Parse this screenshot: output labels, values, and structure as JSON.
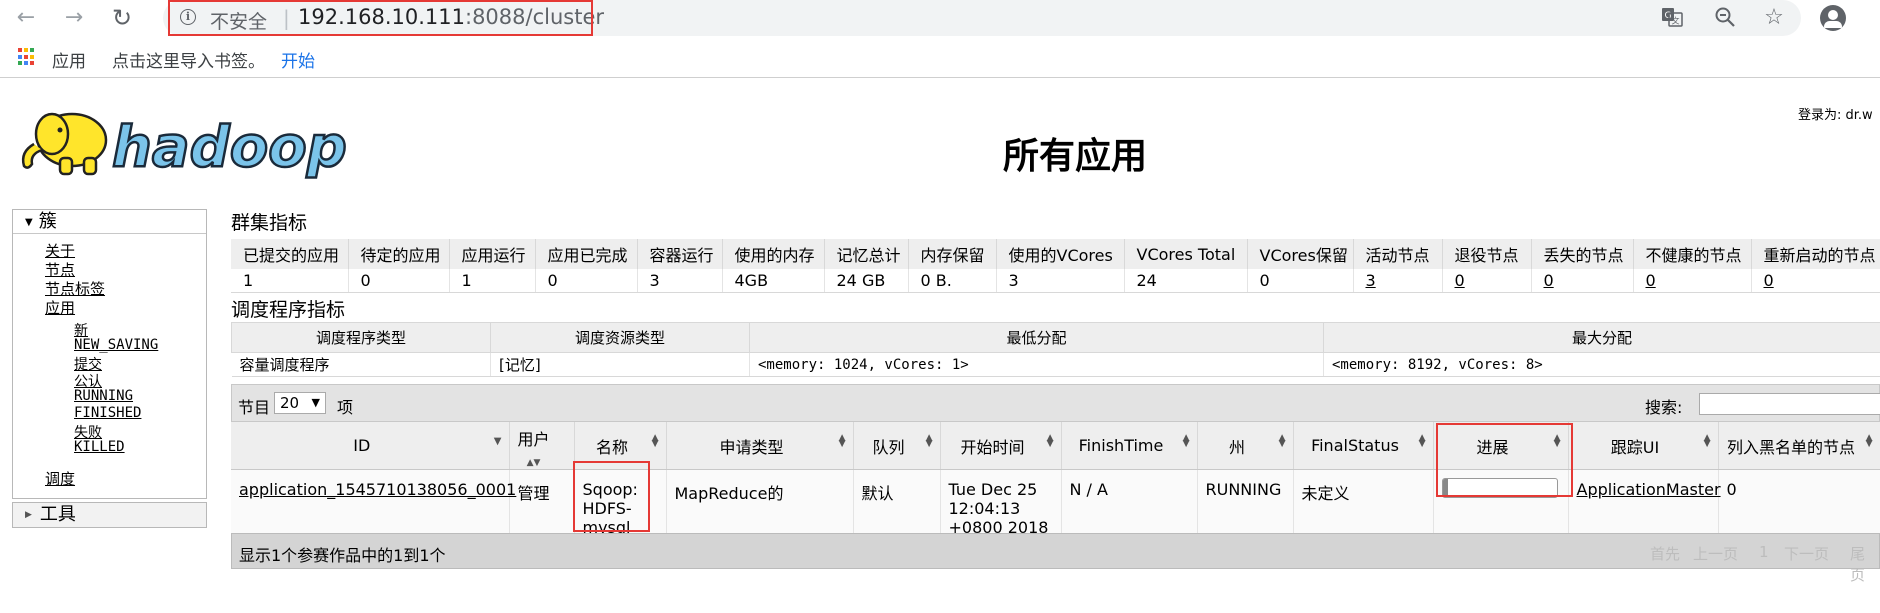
{
  "browser": {
    "not_secure_label": "不安全",
    "url_host": "192.168.10.111",
    "url_rest": ":8088/cluster",
    "bookmarks": {
      "apps_label": "应用",
      "import_hint": "点击这里导入书签。",
      "start_label": "开始"
    },
    "icons": [
      "back-icon",
      "forward-icon",
      "reload-icon",
      "info-icon",
      "translate-icon",
      "zoom-icon",
      "star-icon",
      "profile-icon",
      "apps-grid-icon"
    ]
  },
  "header": {
    "logo_text": "hadoop",
    "page_title": "所有应用",
    "logged_in": "登录为: dr.w"
  },
  "sidebar": {
    "cluster_label": "簇",
    "links": [
      "关于",
      "节点",
      "节点标签",
      "应用"
    ],
    "app_states": [
      "新",
      "NEW_SAVING",
      "提交",
      "公认",
      "RUNNING",
      "FINISHED",
      "失败",
      "KILLED"
    ],
    "scheduler_label": "调度",
    "tools_label": "工具"
  },
  "metrics": {
    "title": "群集指标",
    "headers": [
      "已提交的应用",
      "待定的应用",
      "应用运行",
      "应用已完成",
      "容器运行",
      "使用的内存",
      "记忆总计",
      "内存保留",
      "使用的VCores",
      "VCores Total",
      "VCores保留",
      "活动节点",
      "退役节点",
      "丢失的节点",
      "不健康的节点",
      "重新启动的节点"
    ],
    "values": [
      "1",
      "0",
      "1",
      "0",
      "3",
      "4GB",
      "24 GB",
      "0 B.",
      "3",
      "24",
      "0",
      "3",
      "0",
      "0",
      "0",
      "0"
    ]
  },
  "scheduler": {
    "title": "调度程序指标",
    "headers": [
      "调度程序类型",
      "调度资源类型",
      "最低分配",
      "最大分配"
    ],
    "values": [
      "容量调度程序",
      "[记忆]",
      "<memory: 1024, vCores: 1>",
      "<memory: 8192, vCores: 8>"
    ]
  },
  "apps": {
    "entries_label": "节目",
    "entries_value": "20",
    "entries_suffix": "项",
    "search_label": "搜索:",
    "search_value": "",
    "headers": [
      "ID",
      "用户",
      "名称",
      "申请类型",
      "队列",
      "开始时间",
      "FinishTime",
      "州",
      "FinalStatus",
      "进展",
      "跟踪UI",
      "列入黑名单的节点"
    ],
    "rows": [
      {
        "id": "application_1545710138056_0001",
        "user": "管理",
        "name_lines": [
          "Sqoop:",
          "HDFS-",
          "mysql"
        ],
        "type": "MapReduce的",
        "queue": "默认",
        "start_lines": [
          "Tue Dec 25",
          "12:04:13",
          "+0800 2018"
        ],
        "finish": "N / A",
        "state": "RUNNING",
        "final_status": "未定义",
        "progress": 0.05,
        "tracking_ui": "ApplicationMaster",
        "blacklisted": "0"
      }
    ],
    "info": "显示1个参赛作品中的1到1个",
    "pagination": [
      "首先",
      "上一页",
      "1",
      "下一页",
      "尾页"
    ]
  },
  "colors": {
    "highlight_box": "#e53935",
    "table_header_bg": "#eeeeee",
    "link_blue": "#1a73e8"
  }
}
